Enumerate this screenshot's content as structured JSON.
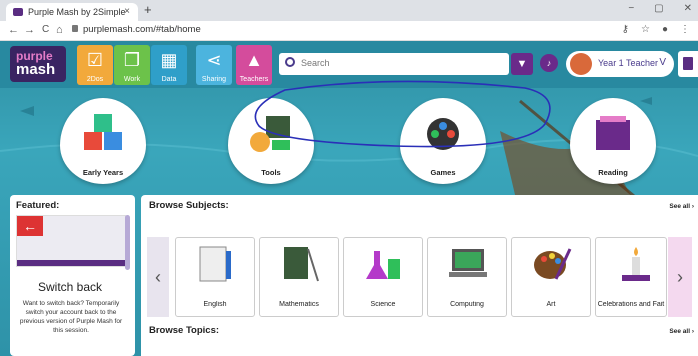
{
  "browser": {
    "tab_title": "Purple Mash by 2Simple",
    "close": "×",
    "new_tab": "+",
    "window": {
      "minimize": "−",
      "maximize": "▢",
      "close": "✕"
    },
    "nav": {
      "back": "←",
      "forward": "→",
      "reload": "C",
      "home": "⌂"
    },
    "url": "purplemash.com/#tab/home",
    "right_icons": {
      "key": "⚷",
      "star": "☆",
      "profile": "●",
      "menu": "⋮"
    }
  },
  "app": {
    "logo_line1": "purple",
    "logo_line2": "mash",
    "tiles": [
      {
        "label": "2Dos",
        "color": "#f2a93b"
      },
      {
        "label": "Work",
        "color": "#6cc24a"
      },
      {
        "label": "Data",
        "color": "#2f9fc9"
      },
      {
        "label": "Sharing",
        "color": "#4cb4de"
      },
      {
        "label": "Teachers",
        "color": "#d44c9c"
      }
    ],
    "search_placeholder": "Search",
    "user_name": "Year 1 Teacher",
    "user_chevron": "V"
  },
  "categories": [
    {
      "label": "Early Years"
    },
    {
      "label": "Tools"
    },
    {
      "label": "Games"
    },
    {
      "label": "Reading"
    }
  ],
  "featured": {
    "heading": "Featured:",
    "title": "Switch back",
    "description": "Want to switch back? Temporarily switch your account back to the previous version of Purple Mash for this session."
  },
  "browse": {
    "subjects_heading": "Browse Subjects:",
    "see_all": "See all",
    "subjects": [
      "English",
      "Mathematics",
      "Science",
      "Computing",
      "Art",
      "Celebrations and Fait"
    ],
    "topics_heading": "Browse Topics:",
    "topics_see_all": "See all",
    "prev": "‹",
    "next": "›"
  }
}
